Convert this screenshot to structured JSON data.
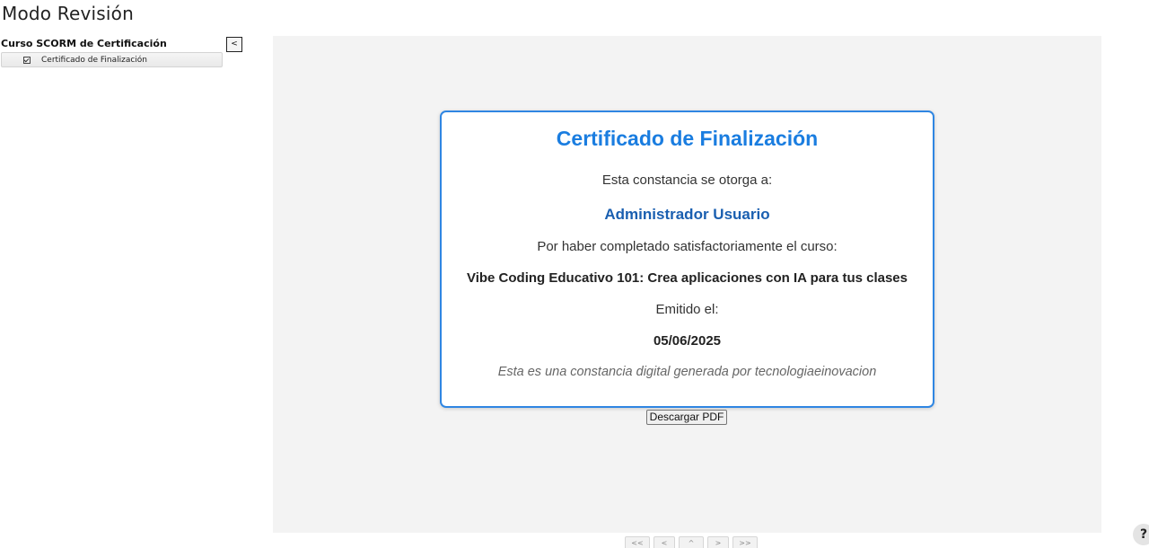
{
  "page": {
    "title": "Modo Revisión"
  },
  "sidebar": {
    "course_title": "Curso SCORM de Certificación",
    "collapse_label": "<",
    "items": [
      {
        "label": "Certificado de Finalización",
        "icon": "checkbox-checked-icon"
      }
    ]
  },
  "certificate": {
    "heading": "Certificado de Finalización",
    "awarded_to": "Esta constancia se otorga a:",
    "recipient": "Administrador Usuario",
    "completed_text": "Por haber completado satisfactoriamente el curso:",
    "course_name": "Vibe Coding Educativo 101: Crea aplicaciones con IA para tus clases",
    "issued_label": "Emitido el:",
    "issued_date": "05/06/2025",
    "footer": "Esta es una constancia digital generada por tecnologiaeinovacion",
    "colors": {
      "border": "#2f86e2",
      "heading": "#1a7de0",
      "recipient": "#1a5fb0"
    }
  },
  "actions": {
    "download_label": "Descargar PDF"
  },
  "nav": {
    "first": "<<",
    "prev": "<",
    "up": "^",
    "next": ">",
    "last": ">>"
  },
  "help": {
    "label": "?"
  }
}
